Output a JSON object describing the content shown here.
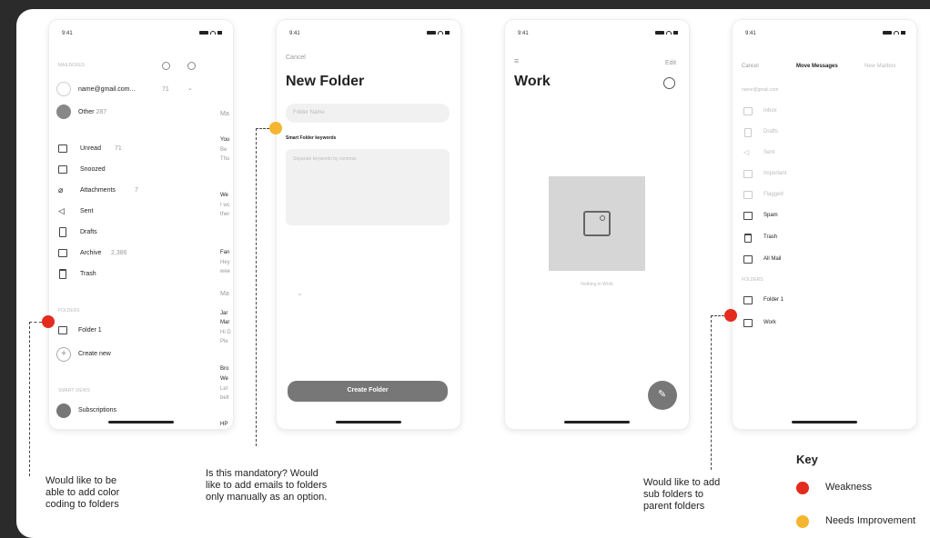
{
  "status_time": "9:41",
  "screen1": {
    "section_mailboxes": "MAILBOXES",
    "account": "name@gmail.com...",
    "account_count": "71",
    "other": "Other",
    "other_count": "287",
    "items": [
      {
        "label": "Unread",
        "count": "71"
      },
      {
        "label": "Snoozed",
        "count": ""
      },
      {
        "label": "Attachments",
        "count": "7"
      },
      {
        "label": "Sent",
        "count": ""
      },
      {
        "label": "Drafts",
        "count": ""
      },
      {
        "label": "Archive",
        "count": "2,386"
      },
      {
        "label": "Trash",
        "count": ""
      }
    ],
    "section_folders": "FOLDERS",
    "folder1": "Folder 1",
    "create_new": "Create new",
    "section_smart": "SMART VIEWS",
    "subscriptions": "Subscriptions",
    "peek": [
      "Ma",
      "You",
      "Be",
      "Thu",
      "We",
      "I wc",
      "ther",
      "Fan",
      "Hey",
      "wee",
      "Ma",
      "Jar",
      "Mar",
      "Hi D",
      "Ple",
      "Bro",
      "We",
      "Let",
      "belt",
      "HP"
    ]
  },
  "screen2": {
    "cancel": "Cancel",
    "title": "New Folder",
    "name_placeholder": "Folder Name",
    "keywords_label": "Smart Folder keywords",
    "keywords_placeholder": "Separate keywords by commas",
    "create_button": "Create Folder"
  },
  "screen3": {
    "edit": "Edit",
    "title": "Work",
    "empty": "Nothing in Work"
  },
  "screen4": {
    "cancel": "Cancel",
    "title": "Move Messages",
    "new_mailbox": "New Mailbox",
    "section_account": "name@gmail.com",
    "faint_items": [
      "Inbox",
      "Drafts",
      "Sent",
      "Important",
      "Flagged"
    ],
    "items": [
      "Spam",
      "Trash",
      "All Mail"
    ],
    "section_folders": "FOLDERS",
    "folder1": "Folder 1",
    "work": "Work"
  },
  "notes": {
    "n1": "Would like to be\nable to add color\ncoding to folders",
    "n2": "Is this mandatory? Would\nlike to add emails to folders\nonly manually as an option.",
    "n3": "Would like to add\nsub folders to\nparent folders"
  },
  "key": {
    "title": "Key",
    "weakness": "Weakness",
    "needs": "Needs Improvement",
    "weakness_color": "#e32c1e",
    "needs_color": "#f5b530"
  }
}
